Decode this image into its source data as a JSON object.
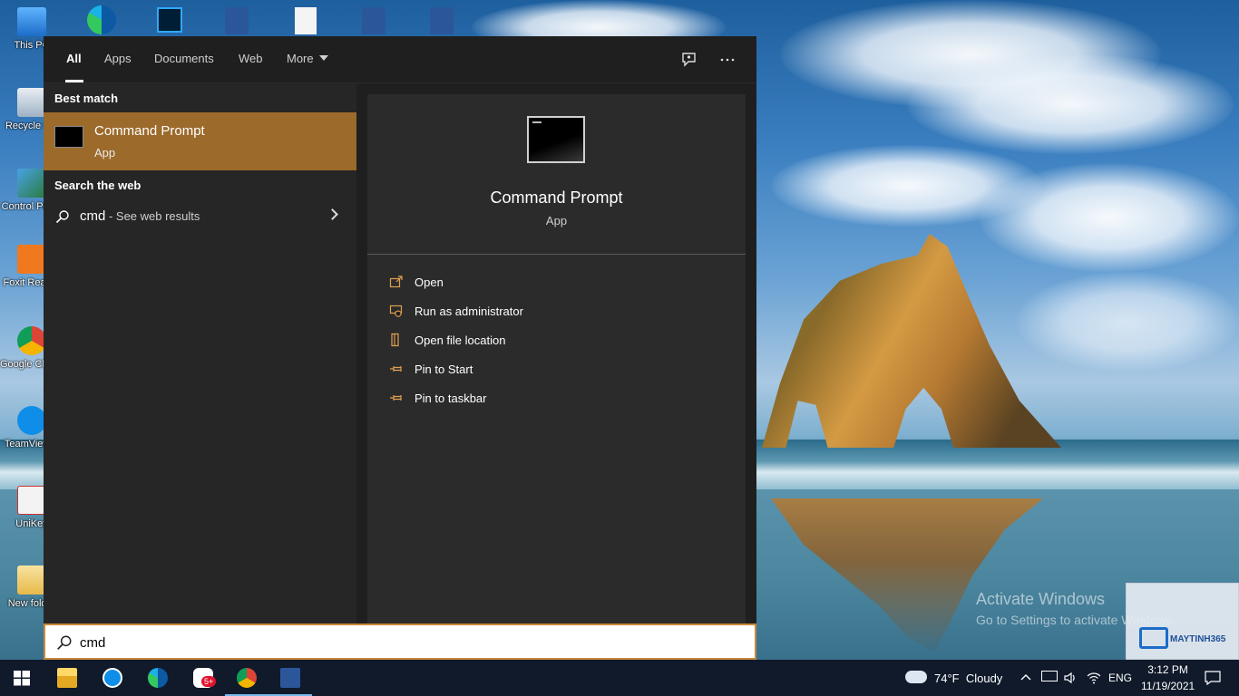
{
  "desktop": {
    "icons": [
      {
        "label": "This PC",
        "icon": "this-pc-icon"
      },
      {
        "label": "Recycle Bin",
        "icon": "recycle-bin-icon"
      },
      {
        "label": "Control Panel",
        "icon": "control-panel-icon"
      },
      {
        "label": "Foxit Reader",
        "icon": "foxit-reader-icon"
      },
      {
        "label": "Google Chrome",
        "icon": "chrome-icon"
      },
      {
        "label": "TeamViewer",
        "icon": "teamviewer-icon"
      },
      {
        "label": "UniKey",
        "icon": "unikey-icon"
      },
      {
        "label": "New folder",
        "icon": "folder-icon"
      }
    ],
    "activation": {
      "title": "Activate Windows",
      "subtitle": "Go to Settings to activate Windows."
    },
    "watermark": {
      "brand": "MAYTINH365"
    }
  },
  "search_panel": {
    "tabs": [
      {
        "label": "All",
        "active": true
      },
      {
        "label": "Apps",
        "active": false
      },
      {
        "label": "Documents",
        "active": false
      },
      {
        "label": "Web",
        "active": false
      },
      {
        "label": "More",
        "active": false
      }
    ],
    "best_match": {
      "heading": "Best match",
      "name": "Command Prompt",
      "type": "App"
    },
    "web": {
      "heading": "Search the web",
      "query": "cmd",
      "suffix": " - See web results"
    },
    "detail": {
      "title": "Command Prompt",
      "subtitle": "App",
      "actions": [
        {
          "label": "Open",
          "icon": "open-icon"
        },
        {
          "label": "Run as administrator",
          "icon": "shield-icon"
        },
        {
          "label": "Open file location",
          "icon": "file-location-icon"
        },
        {
          "label": "Pin to Start",
          "icon": "pin-icon"
        },
        {
          "label": "Pin to taskbar",
          "icon": "pin-icon"
        }
      ]
    },
    "search_input": {
      "value": "cmd"
    }
  },
  "taskbar": {
    "apps": [
      "file-explorer-icon",
      "teamviewer-icon",
      "edge-icon",
      "zalo-icon",
      "chrome-icon",
      "word-icon"
    ],
    "zalo_badge": "5+",
    "weather": {
      "temperature": "74°F",
      "condition": "Cloudy"
    },
    "language": "ENG",
    "clock": {
      "time": "3:12 PM",
      "date": "11/19/2021"
    }
  },
  "colors": {
    "accent": "#9c6a2b",
    "search_border": "#c68a3a",
    "panel_bg": "#1f1f1f",
    "taskbar_bg": "#101a2b"
  }
}
